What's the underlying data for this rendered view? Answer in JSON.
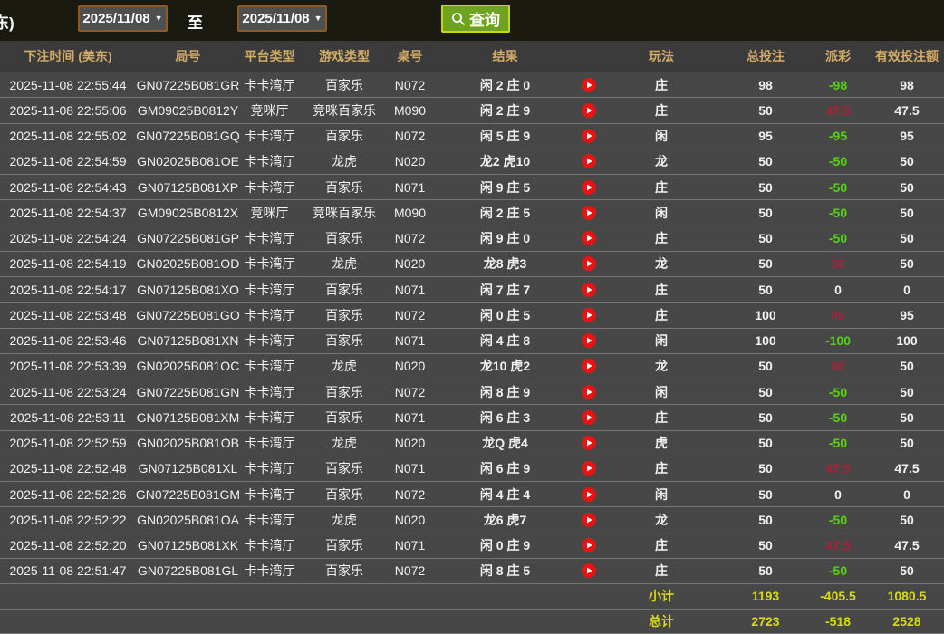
{
  "topbar": {
    "partial_label": "东)",
    "date_from": "2025/11/08",
    "date_to": "2025/11/08",
    "to_label": "至",
    "query_label": "查询",
    "caret": "▼"
  },
  "colors": {
    "accent_green_button": "#6da321",
    "button_border_yellow": "#ccd805",
    "payout_negative_green": "#55d411",
    "payout_positive_red": "#aa2238",
    "summary_yellow": "#d8da12",
    "header_gold": "#d2ab66"
  },
  "table": {
    "headers": [
      "下注时间 (美东)",
      "局号",
      "平台类型",
      "游戏类型",
      "桌号",
      "结果",
      "",
      "玩法",
      "总投注",
      "派彩",
      "有效投注额"
    ],
    "rows": [
      {
        "time": "2025-11-08 22:55:44",
        "game_id": "GN07225B081GR",
        "platform": "卡卡湾厅",
        "game_type": "百家乐",
        "table_no": "N072",
        "result": "闲 2 庄 0",
        "bet_type": "庄",
        "total_bet": "98",
        "payout": "-98",
        "valid_bet": "98"
      },
      {
        "time": "2025-11-08 22:55:06",
        "game_id": "GM09025B0812Y",
        "platform": "竞咪厅",
        "game_type": "竞咪百家乐",
        "table_no": "M090",
        "result": "闲 2 庄 9",
        "bet_type": "庄",
        "total_bet": "50",
        "payout": "47.5",
        "valid_bet": "47.5"
      },
      {
        "time": "2025-11-08 22:55:02",
        "game_id": "GN07225B081GQ",
        "platform": "卡卡湾厅",
        "game_type": "百家乐",
        "table_no": "N072",
        "result": "闲 5 庄 9",
        "bet_type": "闲",
        "total_bet": "95",
        "payout": "-95",
        "valid_bet": "95"
      },
      {
        "time": "2025-11-08 22:54:59",
        "game_id": "GN02025B081OE",
        "platform": "卡卡湾厅",
        "game_type": "龙虎",
        "table_no": "N020",
        "result": "龙2 虎10",
        "bet_type": "龙",
        "total_bet": "50",
        "payout": "-50",
        "valid_bet": "50"
      },
      {
        "time": "2025-11-08 22:54:43",
        "game_id": "GN07125B081XP",
        "platform": "卡卡湾厅",
        "game_type": "百家乐",
        "table_no": "N071",
        "result": "闲 9 庄 5",
        "bet_type": "庄",
        "total_bet": "50",
        "payout": "-50",
        "valid_bet": "50"
      },
      {
        "time": "2025-11-08 22:54:37",
        "game_id": "GM09025B0812X",
        "platform": "竞咪厅",
        "game_type": "竞咪百家乐",
        "table_no": "M090",
        "result": "闲 2 庄 5",
        "bet_type": "闲",
        "total_bet": "50",
        "payout": "-50",
        "valid_bet": "50"
      },
      {
        "time": "2025-11-08 22:54:24",
        "game_id": "GN07225B081GP",
        "platform": "卡卡湾厅",
        "game_type": "百家乐",
        "table_no": "N072",
        "result": "闲 9 庄 0",
        "bet_type": "庄",
        "total_bet": "50",
        "payout": "-50",
        "valid_bet": "50"
      },
      {
        "time": "2025-11-08 22:54:19",
        "game_id": "GN02025B081OD",
        "platform": "卡卡湾厅",
        "game_type": "龙虎",
        "table_no": "N020",
        "result": "龙8 虎3",
        "bet_type": "龙",
        "total_bet": "50",
        "payout": "50",
        "valid_bet": "50"
      },
      {
        "time": "2025-11-08 22:54:17",
        "game_id": "GN07125B081XO",
        "platform": "卡卡湾厅",
        "game_type": "百家乐",
        "table_no": "N071",
        "result": "闲 7 庄 7",
        "bet_type": "庄",
        "total_bet": "50",
        "payout": "0",
        "valid_bet": "0"
      },
      {
        "time": "2025-11-08 22:53:48",
        "game_id": "GN07225B081GO",
        "platform": "卡卡湾厅",
        "game_type": "百家乐",
        "table_no": "N072",
        "result": "闲 0 庄 5",
        "bet_type": "庄",
        "total_bet": "100",
        "payout": "95",
        "valid_bet": "95"
      },
      {
        "time": "2025-11-08 22:53:46",
        "game_id": "GN07125B081XN",
        "platform": "卡卡湾厅",
        "game_type": "百家乐",
        "table_no": "N071",
        "result": "闲 4 庄 8",
        "bet_type": "闲",
        "total_bet": "100",
        "payout": "-100",
        "valid_bet": "100"
      },
      {
        "time": "2025-11-08 22:53:39",
        "game_id": "GN02025B081OC",
        "platform": "卡卡湾厅",
        "game_type": "龙虎",
        "table_no": "N020",
        "result": "龙10 虎2",
        "bet_type": "龙",
        "total_bet": "50",
        "payout": "50",
        "valid_bet": "50"
      },
      {
        "time": "2025-11-08 22:53:24",
        "game_id": "GN07225B081GN",
        "platform": "卡卡湾厅",
        "game_type": "百家乐",
        "table_no": "N072",
        "result": "闲 8 庄 9",
        "bet_type": "闲",
        "total_bet": "50",
        "payout": "-50",
        "valid_bet": "50"
      },
      {
        "time": "2025-11-08 22:53:11",
        "game_id": "GN07125B081XM",
        "platform": "卡卡湾厅",
        "game_type": "百家乐",
        "table_no": "N071",
        "result": "闲 6 庄 3",
        "bet_type": "庄",
        "total_bet": "50",
        "payout": "-50",
        "valid_bet": "50"
      },
      {
        "time": "2025-11-08 22:52:59",
        "game_id": "GN02025B081OB",
        "platform": "卡卡湾厅",
        "game_type": "龙虎",
        "table_no": "N020",
        "result": "龙Q 虎4",
        "bet_type": "虎",
        "total_bet": "50",
        "payout": "-50",
        "valid_bet": "50"
      },
      {
        "time": "2025-11-08 22:52:48",
        "game_id": "GN07125B081XL",
        "platform": "卡卡湾厅",
        "game_type": "百家乐",
        "table_no": "N071",
        "result": "闲 6 庄 9",
        "bet_type": "庄",
        "total_bet": "50",
        "payout": "47.5",
        "valid_bet": "47.5"
      },
      {
        "time": "2025-11-08 22:52:26",
        "game_id": "GN07225B081GM",
        "platform": "卡卡湾厅",
        "game_type": "百家乐",
        "table_no": "N072",
        "result": "闲 4 庄 4",
        "bet_type": "闲",
        "total_bet": "50",
        "payout": "0",
        "valid_bet": "0"
      },
      {
        "time": "2025-11-08 22:52:22",
        "game_id": "GN02025B081OA",
        "platform": "卡卡湾厅",
        "game_type": "龙虎",
        "table_no": "N020",
        "result": "龙6 虎7",
        "bet_type": "龙",
        "total_bet": "50",
        "payout": "-50",
        "valid_bet": "50"
      },
      {
        "time": "2025-11-08 22:52:20",
        "game_id": "GN07125B081XK",
        "platform": "卡卡湾厅",
        "game_type": "百家乐",
        "table_no": "N071",
        "result": "闲 0 庄 9",
        "bet_type": "庄",
        "total_bet": "50",
        "payout": "47.5",
        "valid_bet": "47.5"
      },
      {
        "time": "2025-11-08 22:51:47",
        "game_id": "GN07225B081GL",
        "platform": "卡卡湾厅",
        "game_type": "百家乐",
        "table_no": "N072",
        "result": "闲 8 庄 5",
        "bet_type": "庄",
        "total_bet": "50",
        "payout": "-50",
        "valid_bet": "50"
      }
    ],
    "subtotal": {
      "label": "小计",
      "total_bet": "1193",
      "payout": "-405.5",
      "valid_bet": "1080.5"
    },
    "grand_total": {
      "label": "总计",
      "total_bet": "2723",
      "payout": "-518",
      "valid_bet": "2528"
    }
  }
}
